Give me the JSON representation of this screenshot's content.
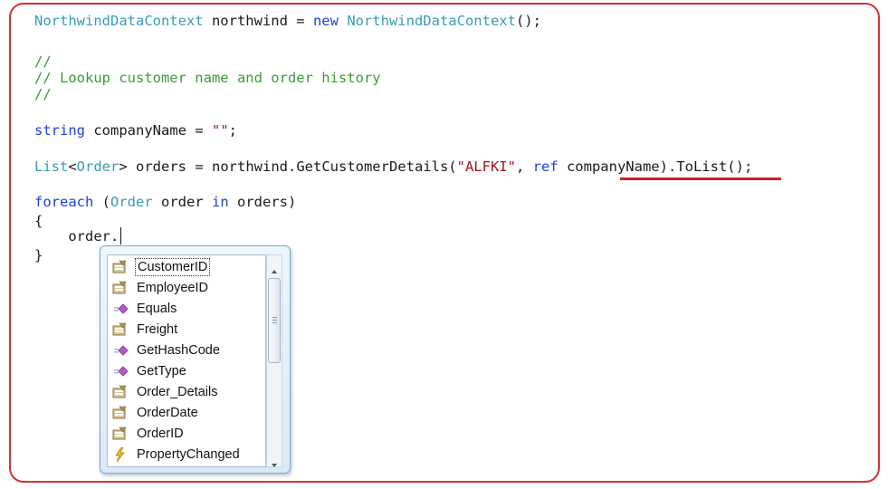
{
  "code": {
    "line1": {
      "type1": "NorthwindDataContext",
      "var": " northwind = ",
      "kw": "new",
      "sp": " ",
      "type2": "NorthwindDataContext",
      "end": "();"
    },
    "line2": {
      "comment": "//"
    },
    "line3": {
      "comment": "// Lookup customer name and order history"
    },
    "line4": {
      "comment": "//"
    },
    "line5": {
      "kw": "string",
      "rest": " companyName = ",
      "str": "\"\"",
      "end": ";"
    },
    "line6": {
      "type1": "List",
      "lt": "<",
      "type2": "Order",
      "gt": ">",
      "rest": " orders = northwind.GetCustomerDetails(",
      "str": "\"ALFKI\"",
      "comma": ", ",
      "kw": "ref",
      "arg": " companyName",
      "end": ").ToList();"
    },
    "line7": {
      "kw1": "foreach",
      "paren": " (",
      "type": "Order",
      "mid": " order ",
      "kw2": "in",
      "end": " orders)"
    },
    "line8": {
      "text": "{"
    },
    "line9": {
      "text": "    order."
    },
    "line10": {
      "text": "}"
    }
  },
  "intellisense": {
    "items": [
      {
        "label": "CustomerID",
        "icon": "property-icon"
      },
      {
        "label": "EmployeeID",
        "icon": "property-icon"
      },
      {
        "label": "Equals",
        "icon": "method-icon"
      },
      {
        "label": "Freight",
        "icon": "property-icon"
      },
      {
        "label": "GetHashCode",
        "icon": "method-icon"
      },
      {
        "label": "GetType",
        "icon": "method-icon"
      },
      {
        "label": "Order_Details",
        "icon": "property-icon"
      },
      {
        "label": "OrderDate",
        "icon": "property-icon"
      },
      {
        "label": "OrderID",
        "icon": "property-icon"
      },
      {
        "label": "PropertyChanged",
        "icon": "event-icon"
      }
    ],
    "selected_index": 0
  },
  "colors": {
    "keyword": "#1f3fe0",
    "type": "#3a9bb5",
    "comment": "#3a9a3a",
    "string": "#a31515",
    "highlight": "#d21f1f"
  }
}
